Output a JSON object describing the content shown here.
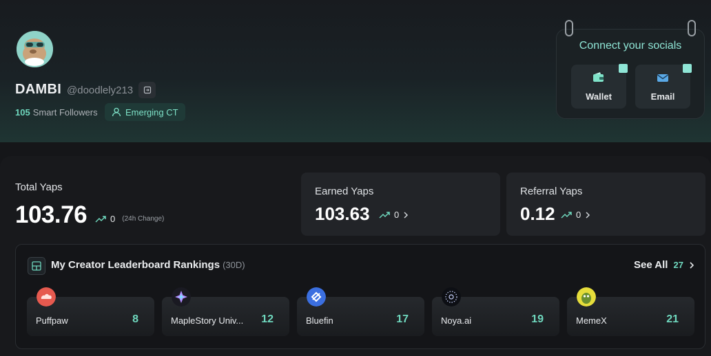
{
  "profile": {
    "name": "DAMBI",
    "handle": "@doodlely213",
    "smart_followers_count": "105",
    "smart_followers_label": "Smart Followers",
    "badge": "Emerging CT"
  },
  "socials": {
    "title": "Connect your socials",
    "items": [
      {
        "label": "Wallet",
        "icon": "wallet-icon"
      },
      {
        "label": "Email",
        "icon": "mail-icon"
      }
    ]
  },
  "stats": {
    "total": {
      "label": "Total Yaps",
      "value": "103.76",
      "change": "0",
      "change_note": "(24h Change)"
    },
    "earned": {
      "label": "Earned Yaps",
      "value": "103.63",
      "change": "0"
    },
    "referral": {
      "label": "Referral Yaps",
      "value": "0.12",
      "change": "0"
    }
  },
  "leaderboard": {
    "title": "My Creator Leaderboard Rankings",
    "period": "(30D)",
    "see_all_label": "See All",
    "see_all_count": "27",
    "projects": [
      {
        "name": "Puffpaw",
        "rank": "8",
        "logo_color": "#e65a4f"
      },
      {
        "name": "MapleStory Univ...",
        "rank": "12",
        "logo_color": "#1a1a22"
      },
      {
        "name": "Bluefin",
        "rank": "17",
        "logo_color": "#3b6fe0"
      },
      {
        "name": "Noya.ai",
        "rank": "19",
        "logo_color": "#0d0f14"
      },
      {
        "name": "MemeX",
        "rank": "21",
        "logo_color": "#e6dd3b"
      }
    ]
  },
  "colors": {
    "accent": "#6fd8be",
    "background": "#151619"
  }
}
